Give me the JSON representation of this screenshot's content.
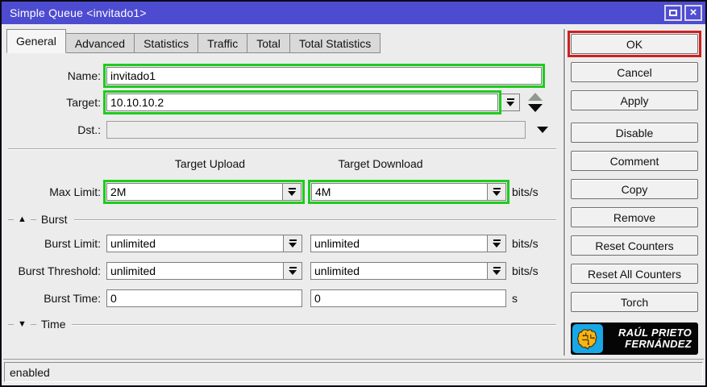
{
  "window": {
    "title": "Simple Queue <invitado1>",
    "status": "enabled"
  },
  "tabs": [
    {
      "label": "General",
      "active": true
    },
    {
      "label": "Advanced",
      "active": false
    },
    {
      "label": "Statistics",
      "active": false
    },
    {
      "label": "Traffic",
      "active": false
    },
    {
      "label": "Total",
      "active": false
    },
    {
      "label": "Total Statistics",
      "active": false
    }
  ],
  "form": {
    "name": {
      "label": "Name:",
      "value": "invitado1"
    },
    "target": {
      "label": "Target:",
      "value": "10.10.10.2"
    },
    "dst": {
      "label": "Dst.:",
      "value": ""
    },
    "column_headers": {
      "upload": "Target Upload",
      "download": "Target Download"
    },
    "max_limit": {
      "label": "Max Limit:",
      "upload": "2M",
      "download": "4M",
      "unit": "bits/s"
    },
    "burst_section": "Burst",
    "burst_limit": {
      "label": "Burst Limit:",
      "upload": "unlimited",
      "download": "unlimited",
      "unit": "bits/s"
    },
    "burst_threshold": {
      "label": "Burst Threshold:",
      "upload": "unlimited",
      "download": "unlimited",
      "unit": "bits/s"
    },
    "burst_time": {
      "label": "Burst Time:",
      "upload": "0",
      "download": "0",
      "unit": "s"
    },
    "time_section": "Time"
  },
  "action_buttons": [
    "OK",
    "Cancel",
    "Apply",
    "Disable",
    "Comment",
    "Copy",
    "Remove",
    "Reset Counters",
    "Reset All Counters",
    "Torch"
  ],
  "logo": {
    "line1": "RAÚL PRIETO",
    "line2": "FERNÁNDEZ"
  },
  "icons": {
    "close": "×",
    "burst_collapse": "▲",
    "time_collapse": "▼"
  },
  "colors": {
    "titlebar": "#4d4bd0",
    "annotation_green": "#1ecb1e",
    "annotation_red": "#cf2020",
    "logo_icon_bg": "#18a8e8",
    "logo_brain": "#f7b615",
    "logo_bg": "#050505"
  }
}
